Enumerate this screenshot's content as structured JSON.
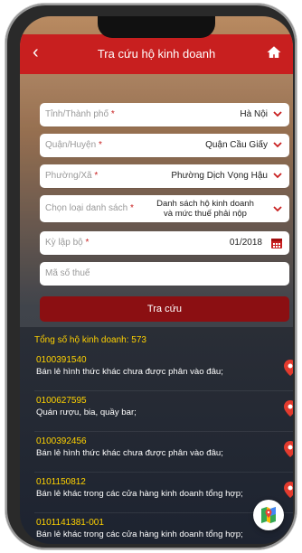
{
  "header": {
    "title": "Tra cứu hộ kinh doanh",
    "back_icon": "chevron-left-icon",
    "home_icon": "home-icon"
  },
  "form": {
    "province": {
      "label": "Tỉnh/Thành phố",
      "value": "Hà Nội"
    },
    "district": {
      "label": "Quận/Huyện",
      "value": "Quận Cầu Giấy"
    },
    "ward": {
      "label": "Phường/Xã",
      "value": "Phường Dịch Vọng Hậu"
    },
    "list_type": {
      "label": "Chọn loại danh sách",
      "value_line1": "Danh sách hộ kinh doanh",
      "value_line2": "và mức thuế phải nộp"
    },
    "period": {
      "label": "Kỳ lập bộ",
      "value": "01/2018"
    },
    "tax_code": {
      "placeholder": "Mã số thuế"
    },
    "search_button": "Tra cứu"
  },
  "results": {
    "total_label": "Tổng số hộ kinh doanh: 573",
    "items": [
      {
        "code": "0100391540",
        "desc": "Bán lẻ hình thức khác chưa được phân vào đâu;"
      },
      {
        "code": "0100627595",
        "desc": "Quán rượu, bia, quầy bar;"
      },
      {
        "code": "0100392456",
        "desc": "Bán lẻ hình thức khác chưa được phân vào đâu;"
      },
      {
        "code": "0101150812",
        "desc": "Bán lẻ khác trong các cửa hàng kinh doanh tổng hợp;"
      },
      {
        "code": "0101141381-001",
        "desc": "Bán lẻ khác trong các cửa hàng kinh doanh tổng hợp;"
      }
    ]
  },
  "colors": {
    "accent": "#c81f1f",
    "button": "#8b0f12",
    "highlight": "#ffd200"
  }
}
